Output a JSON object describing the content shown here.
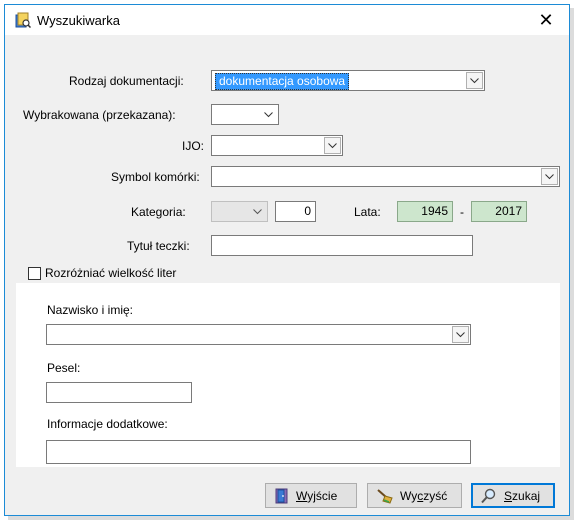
{
  "window": {
    "title": "Wyszukiwarka",
    "close_glyph": "✕"
  },
  "fields": {
    "rodzaj_label": "Rodzaj dokumentacji:",
    "rodzaj_value": "dokumentacja osobowa",
    "wybrakowana_label": "Wybrakowana (przekazana):",
    "wybrakowana_value": "",
    "ijo_label": "IJO:",
    "ijo_value": "",
    "symbol_label": "Symbol komórki:",
    "symbol_value": "",
    "kategoria_label": "Kategoria:",
    "kategoria_value": "",
    "kategoria_number": "0",
    "lata_label": "Lata:",
    "lata_from": "1945",
    "lata_separator": "-",
    "lata_to": "2017",
    "tytul_label": "Tytuł teczki:",
    "tytul_value": "",
    "case_sensitive_label": "Rozróżniać wielkość liter",
    "case_sensitive_checked": false
  },
  "panel": {
    "nazwisko_label": "Nazwisko i imię:",
    "nazwisko_value": "",
    "pesel_label": "Pesel:",
    "pesel_value": "",
    "info_label": "Informacje dodatkowe:",
    "info_value": ""
  },
  "buttons": {
    "exit": {
      "pre": "",
      "u": "W",
      "post": "yjście",
      "icon": "door-icon"
    },
    "clear": {
      "pre": "Wy",
      "u": "c",
      "post": "zyść",
      "icon": "broom-icon"
    },
    "search": {
      "pre": "",
      "u": "S",
      "post": "zukaj",
      "icon": "magnifier-icon"
    }
  },
  "colors": {
    "accent": "#0078d7",
    "selection": "#3399ff",
    "year_field": "#cde6cd"
  }
}
